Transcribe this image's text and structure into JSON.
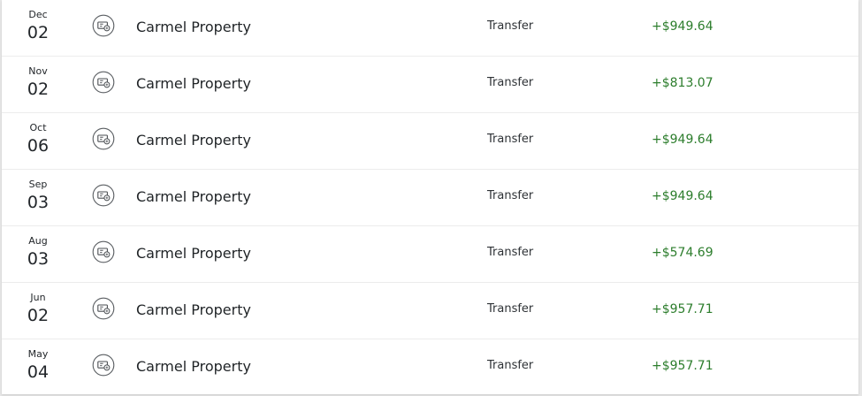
{
  "colors": {
    "credit_amount": "#2c7d2c",
    "text_primary": "#1f2326",
    "divider": "#ececec"
  },
  "transactions": [
    {
      "month": "Dec",
      "day": "02",
      "icon": "transfer-icon",
      "merchant": "Carmel Property",
      "category": "Transfer",
      "amount": "+$949.64"
    },
    {
      "month": "Nov",
      "day": "02",
      "icon": "transfer-icon",
      "merchant": "Carmel Property",
      "category": "Transfer",
      "amount": "+$813.07"
    },
    {
      "month": "Oct",
      "day": "06",
      "icon": "transfer-icon",
      "merchant": "Carmel Property",
      "category": "Transfer",
      "amount": "+$949.64"
    },
    {
      "month": "Sep",
      "day": "03",
      "icon": "transfer-icon",
      "merchant": "Carmel Property",
      "category": "Transfer",
      "amount": "+$949.64"
    },
    {
      "month": "Aug",
      "day": "03",
      "icon": "transfer-icon",
      "merchant": "Carmel Property",
      "category": "Transfer",
      "amount": "+$574.69"
    },
    {
      "month": "Jun",
      "day": "02",
      "icon": "transfer-icon",
      "merchant": "Carmel Property",
      "category": "Transfer",
      "amount": "+$957.71"
    },
    {
      "month": "May",
      "day": "04",
      "icon": "transfer-icon",
      "merchant": "Carmel Property",
      "category": "Transfer",
      "amount": "+$957.71"
    }
  ]
}
